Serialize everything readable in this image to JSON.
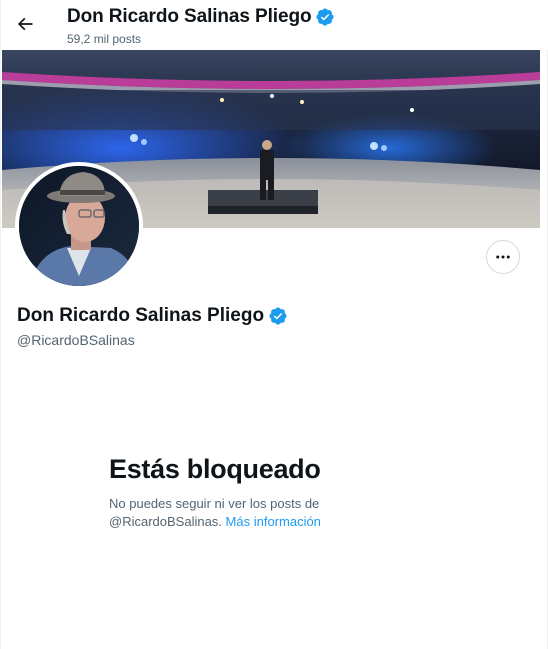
{
  "header": {
    "title": "Don Ricardo Salinas Pliego",
    "post_count": "59,2 mil posts"
  },
  "profile": {
    "name": "Don Ricardo Salinas Pliego",
    "handle": "@RicardoBSalinas",
    "verified_icon": "verified-badge-icon",
    "more_icon": "more-horizontal-icon"
  },
  "blocked": {
    "title": "Estás bloqueado",
    "message_line1": "No puedes seguir ni ver los posts de",
    "message_line2": "@RicardoBSalinas.",
    "link": "Más información"
  },
  "colors": {
    "accent": "#1d9bf0",
    "text_primary": "#0f1419",
    "text_secondary": "#536471"
  }
}
